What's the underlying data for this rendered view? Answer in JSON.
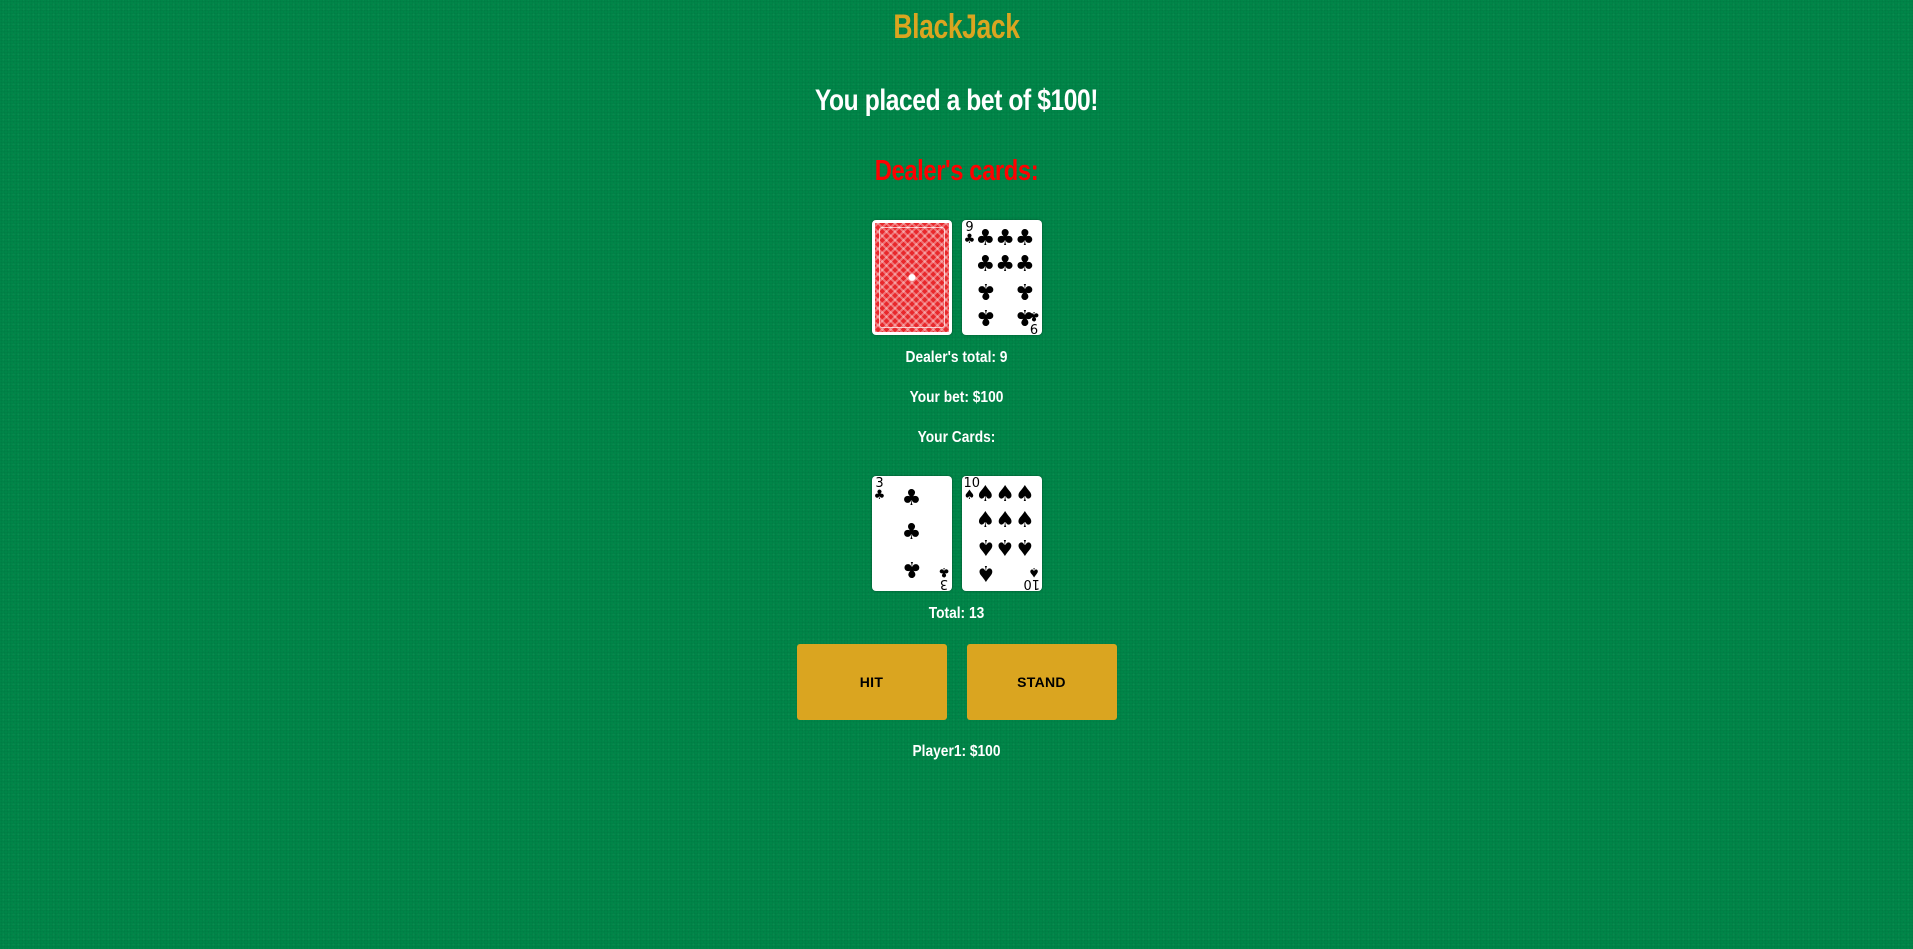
{
  "header": {
    "title": "BlackJack",
    "bet_message": "You placed a bet of $100!"
  },
  "dealer": {
    "heading": "Dealer's cards:",
    "cards": [
      {
        "face_down": true
      },
      {
        "rank": "9",
        "suit": "♣",
        "suit_name": "clubs"
      }
    ],
    "total_label": "Dealer's total: 9"
  },
  "bet": {
    "label": "Your bet: $100"
  },
  "player": {
    "cards_label": "Your Cards:",
    "cards": [
      {
        "rank": "3",
        "suit": "♣",
        "suit_name": "clubs"
      },
      {
        "rank": "10",
        "suit": "♠",
        "suit_name": "spades"
      }
    ],
    "total_label": "Total: 13",
    "bank_label": "Player1: $100"
  },
  "actions": {
    "hit_label": "HIT",
    "stand_label": "STAND"
  },
  "colors": {
    "table_felt": "#008548",
    "title": "#daa520",
    "dealer_heading": "#ff0000",
    "button": "#daa520",
    "card_back": "#e8282c"
  }
}
